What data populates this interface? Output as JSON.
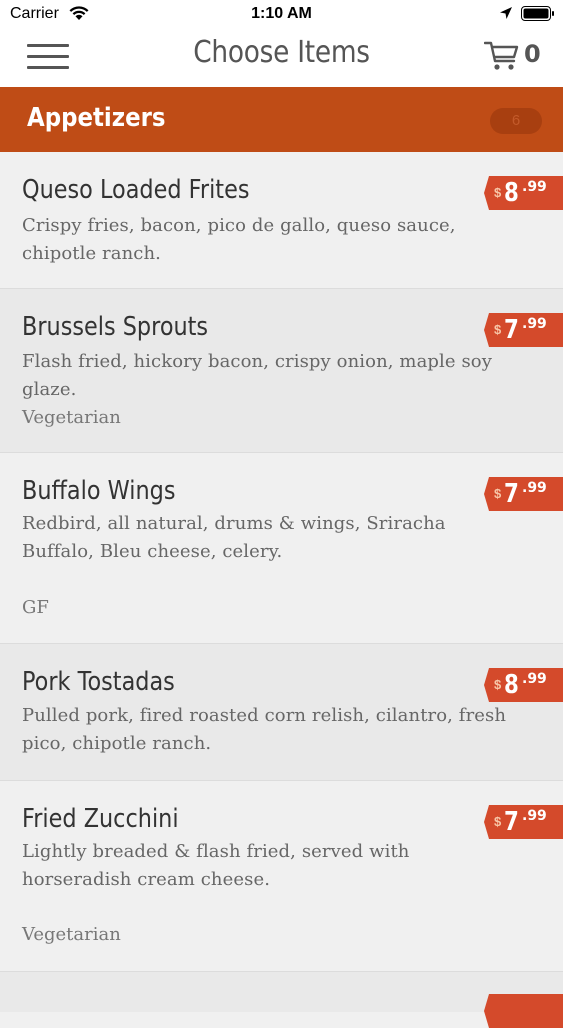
{
  "status": {
    "carrier": "Carrier",
    "time": "1:10 AM"
  },
  "nav": {
    "title": "Choose Items",
    "cart_count": "0"
  },
  "category": {
    "title": "Appetizers",
    "count": "6"
  },
  "colors": {
    "accent": "#bf4c16",
    "price_tag": "#d44a2b"
  },
  "items": [
    {
      "name": "Queso Loaded Frites",
      "description": "Crispy fries, bacon, pico de gallo, queso sauce, chipotle ranch.",
      "tag": "",
      "price_dollar_sign": "$",
      "price_whole": "8",
      "price_cents": ".99"
    },
    {
      "name": "Brussels Sprouts",
      "description": "Flash fried, hickory bacon, crispy onion, maple soy glaze.",
      "tag": "Vegetarian",
      "price_dollar_sign": "$",
      "price_whole": "7",
      "price_cents": ".99"
    },
    {
      "name": "Buffalo Wings",
      "description": "Redbird, all natural, drums & wings, Sriracha Buffalo, Bleu cheese, celery.",
      "tag": "GF",
      "price_dollar_sign": "$",
      "price_whole": "7",
      "price_cents": ".99"
    },
    {
      "name": "Pork Tostadas",
      "description": "Pulled pork, fired roasted corn relish, cilantro, fresh pico, chipotle ranch.",
      "tag": "",
      "price_dollar_sign": "$",
      "price_whole": "8",
      "price_cents": ".99"
    },
    {
      "name": "Fried Zucchini",
      "description": "Lightly breaded & flash fried, served with horseradish cream cheese.",
      "tag": "Vegetarian",
      "price_dollar_sign": "$",
      "price_whole": "7",
      "price_cents": ".99"
    }
  ]
}
